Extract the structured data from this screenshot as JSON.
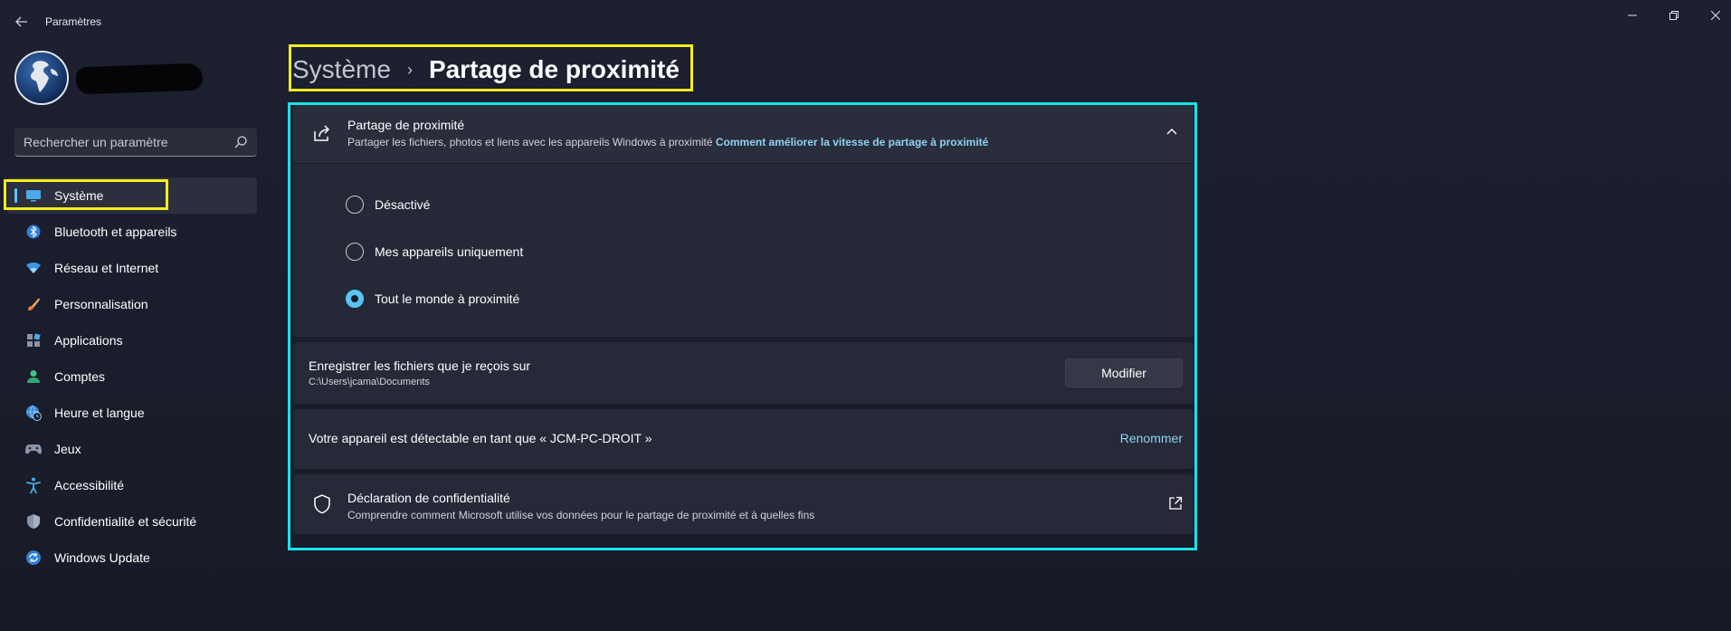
{
  "window": {
    "title": "Paramètres",
    "controls": [
      "minimize-icon",
      "restore-icon",
      "close-icon"
    ]
  },
  "search": {
    "placeholder": "Rechercher un paramètre"
  },
  "sidebar": {
    "items": [
      {
        "label": "Système",
        "icon": "monitor-icon",
        "active": true
      },
      {
        "label": "Bluetooth et appareils",
        "icon": "bluetooth-icon"
      },
      {
        "label": "Réseau et Internet",
        "icon": "wifi-icon"
      },
      {
        "label": "Personnalisation",
        "icon": "brush-icon"
      },
      {
        "label": "Applications",
        "icon": "apps-icon"
      },
      {
        "label": "Comptes",
        "icon": "person-icon"
      },
      {
        "label": "Heure et langue",
        "icon": "globe-clock-icon"
      },
      {
        "label": "Jeux",
        "icon": "gamepad-icon"
      },
      {
        "label": "Accessibilité",
        "icon": "accessibility-icon"
      },
      {
        "label": "Confidentialité et sécurité",
        "icon": "shield-icon"
      },
      {
        "label": "Windows Update",
        "icon": "update-icon"
      }
    ]
  },
  "header": {
    "parent": "Système",
    "separator": "›",
    "current": "Partage de proximité"
  },
  "nearby": {
    "title": "Partage de proximité",
    "subtitle": "Partager les fichiers, photos et liens avec les appareils Windows à proximité",
    "link": "Comment améliorer la vitesse de partage à proximité",
    "options": [
      {
        "label": "Désactivé",
        "selected": false
      },
      {
        "label": "Mes appareils uniquement",
        "selected": false
      },
      {
        "label": "Tout le monde à proximité",
        "selected": true
      }
    ]
  },
  "save": {
    "title": "Enregistrer les fichiers que je reçois sur",
    "path": "C:\\Users\\jcama\\Documents",
    "button": "Modifier"
  },
  "device": {
    "text": "Votre appareil est détectable en tant que « JCM-PC-DROIT »",
    "rename": "Renommer"
  },
  "privacy": {
    "title": "Déclaration de confidentialité",
    "subtitle": "Comprendre comment Microsoft utilise vos données pour le partage de proximité et à quelles fins"
  },
  "colors": {
    "accent": "#58c4f5",
    "link": "#8fd3f4",
    "highlight_yellow": "#f5ee1e",
    "highlight_cyan": "#18e3ea"
  }
}
